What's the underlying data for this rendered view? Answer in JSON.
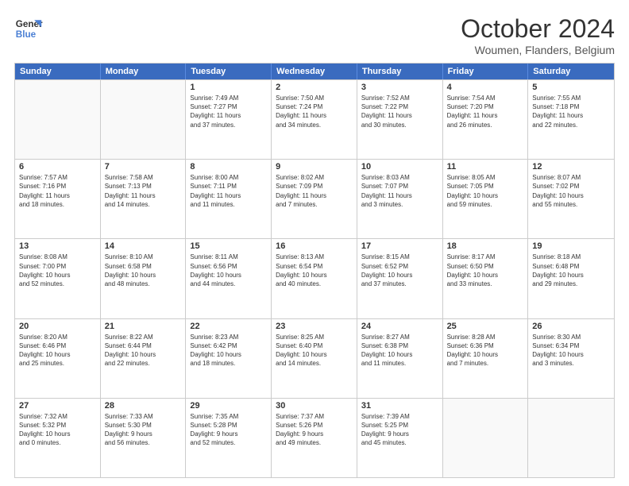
{
  "logo": {
    "line1": "General",
    "line2": "Blue"
  },
  "title": "October 2024",
  "location": "Woumen, Flanders, Belgium",
  "header": {
    "days": [
      "Sunday",
      "Monday",
      "Tuesday",
      "Wednesday",
      "Thursday",
      "Friday",
      "Saturday"
    ]
  },
  "rows": [
    [
      {
        "day": "",
        "lines": []
      },
      {
        "day": "",
        "lines": []
      },
      {
        "day": "1",
        "lines": [
          "Sunrise: 7:49 AM",
          "Sunset: 7:27 PM",
          "Daylight: 11 hours",
          "and 37 minutes."
        ]
      },
      {
        "day": "2",
        "lines": [
          "Sunrise: 7:50 AM",
          "Sunset: 7:24 PM",
          "Daylight: 11 hours",
          "and 34 minutes."
        ]
      },
      {
        "day": "3",
        "lines": [
          "Sunrise: 7:52 AM",
          "Sunset: 7:22 PM",
          "Daylight: 11 hours",
          "and 30 minutes."
        ]
      },
      {
        "day": "4",
        "lines": [
          "Sunrise: 7:54 AM",
          "Sunset: 7:20 PM",
          "Daylight: 11 hours",
          "and 26 minutes."
        ]
      },
      {
        "day": "5",
        "lines": [
          "Sunrise: 7:55 AM",
          "Sunset: 7:18 PM",
          "Daylight: 11 hours",
          "and 22 minutes."
        ]
      }
    ],
    [
      {
        "day": "6",
        "lines": [
          "Sunrise: 7:57 AM",
          "Sunset: 7:16 PM",
          "Daylight: 11 hours",
          "and 18 minutes."
        ]
      },
      {
        "day": "7",
        "lines": [
          "Sunrise: 7:58 AM",
          "Sunset: 7:13 PM",
          "Daylight: 11 hours",
          "and 14 minutes."
        ]
      },
      {
        "day": "8",
        "lines": [
          "Sunrise: 8:00 AM",
          "Sunset: 7:11 PM",
          "Daylight: 11 hours",
          "and 11 minutes."
        ]
      },
      {
        "day": "9",
        "lines": [
          "Sunrise: 8:02 AM",
          "Sunset: 7:09 PM",
          "Daylight: 11 hours",
          "and 7 minutes."
        ]
      },
      {
        "day": "10",
        "lines": [
          "Sunrise: 8:03 AM",
          "Sunset: 7:07 PM",
          "Daylight: 11 hours",
          "and 3 minutes."
        ]
      },
      {
        "day": "11",
        "lines": [
          "Sunrise: 8:05 AM",
          "Sunset: 7:05 PM",
          "Daylight: 10 hours",
          "and 59 minutes."
        ]
      },
      {
        "day": "12",
        "lines": [
          "Sunrise: 8:07 AM",
          "Sunset: 7:02 PM",
          "Daylight: 10 hours",
          "and 55 minutes."
        ]
      }
    ],
    [
      {
        "day": "13",
        "lines": [
          "Sunrise: 8:08 AM",
          "Sunset: 7:00 PM",
          "Daylight: 10 hours",
          "and 52 minutes."
        ]
      },
      {
        "day": "14",
        "lines": [
          "Sunrise: 8:10 AM",
          "Sunset: 6:58 PM",
          "Daylight: 10 hours",
          "and 48 minutes."
        ]
      },
      {
        "day": "15",
        "lines": [
          "Sunrise: 8:11 AM",
          "Sunset: 6:56 PM",
          "Daylight: 10 hours",
          "and 44 minutes."
        ]
      },
      {
        "day": "16",
        "lines": [
          "Sunrise: 8:13 AM",
          "Sunset: 6:54 PM",
          "Daylight: 10 hours",
          "and 40 minutes."
        ]
      },
      {
        "day": "17",
        "lines": [
          "Sunrise: 8:15 AM",
          "Sunset: 6:52 PM",
          "Daylight: 10 hours",
          "and 37 minutes."
        ]
      },
      {
        "day": "18",
        "lines": [
          "Sunrise: 8:17 AM",
          "Sunset: 6:50 PM",
          "Daylight: 10 hours",
          "and 33 minutes."
        ]
      },
      {
        "day": "19",
        "lines": [
          "Sunrise: 8:18 AM",
          "Sunset: 6:48 PM",
          "Daylight: 10 hours",
          "and 29 minutes."
        ]
      }
    ],
    [
      {
        "day": "20",
        "lines": [
          "Sunrise: 8:20 AM",
          "Sunset: 6:46 PM",
          "Daylight: 10 hours",
          "and 25 minutes."
        ]
      },
      {
        "day": "21",
        "lines": [
          "Sunrise: 8:22 AM",
          "Sunset: 6:44 PM",
          "Daylight: 10 hours",
          "and 22 minutes."
        ]
      },
      {
        "day": "22",
        "lines": [
          "Sunrise: 8:23 AM",
          "Sunset: 6:42 PM",
          "Daylight: 10 hours",
          "and 18 minutes."
        ]
      },
      {
        "day": "23",
        "lines": [
          "Sunrise: 8:25 AM",
          "Sunset: 6:40 PM",
          "Daylight: 10 hours",
          "and 14 minutes."
        ]
      },
      {
        "day": "24",
        "lines": [
          "Sunrise: 8:27 AM",
          "Sunset: 6:38 PM",
          "Daylight: 10 hours",
          "and 11 minutes."
        ]
      },
      {
        "day": "25",
        "lines": [
          "Sunrise: 8:28 AM",
          "Sunset: 6:36 PM",
          "Daylight: 10 hours",
          "and 7 minutes."
        ]
      },
      {
        "day": "26",
        "lines": [
          "Sunrise: 8:30 AM",
          "Sunset: 6:34 PM",
          "Daylight: 10 hours",
          "and 3 minutes."
        ]
      }
    ],
    [
      {
        "day": "27",
        "lines": [
          "Sunrise: 7:32 AM",
          "Sunset: 5:32 PM",
          "Daylight: 10 hours",
          "and 0 minutes."
        ]
      },
      {
        "day": "28",
        "lines": [
          "Sunrise: 7:33 AM",
          "Sunset: 5:30 PM",
          "Daylight: 9 hours",
          "and 56 minutes."
        ]
      },
      {
        "day": "29",
        "lines": [
          "Sunrise: 7:35 AM",
          "Sunset: 5:28 PM",
          "Daylight: 9 hours",
          "and 52 minutes."
        ]
      },
      {
        "day": "30",
        "lines": [
          "Sunrise: 7:37 AM",
          "Sunset: 5:26 PM",
          "Daylight: 9 hours",
          "and 49 minutes."
        ]
      },
      {
        "day": "31",
        "lines": [
          "Sunrise: 7:39 AM",
          "Sunset: 5:25 PM",
          "Daylight: 9 hours",
          "and 45 minutes."
        ]
      },
      {
        "day": "",
        "lines": []
      },
      {
        "day": "",
        "lines": []
      }
    ]
  ]
}
